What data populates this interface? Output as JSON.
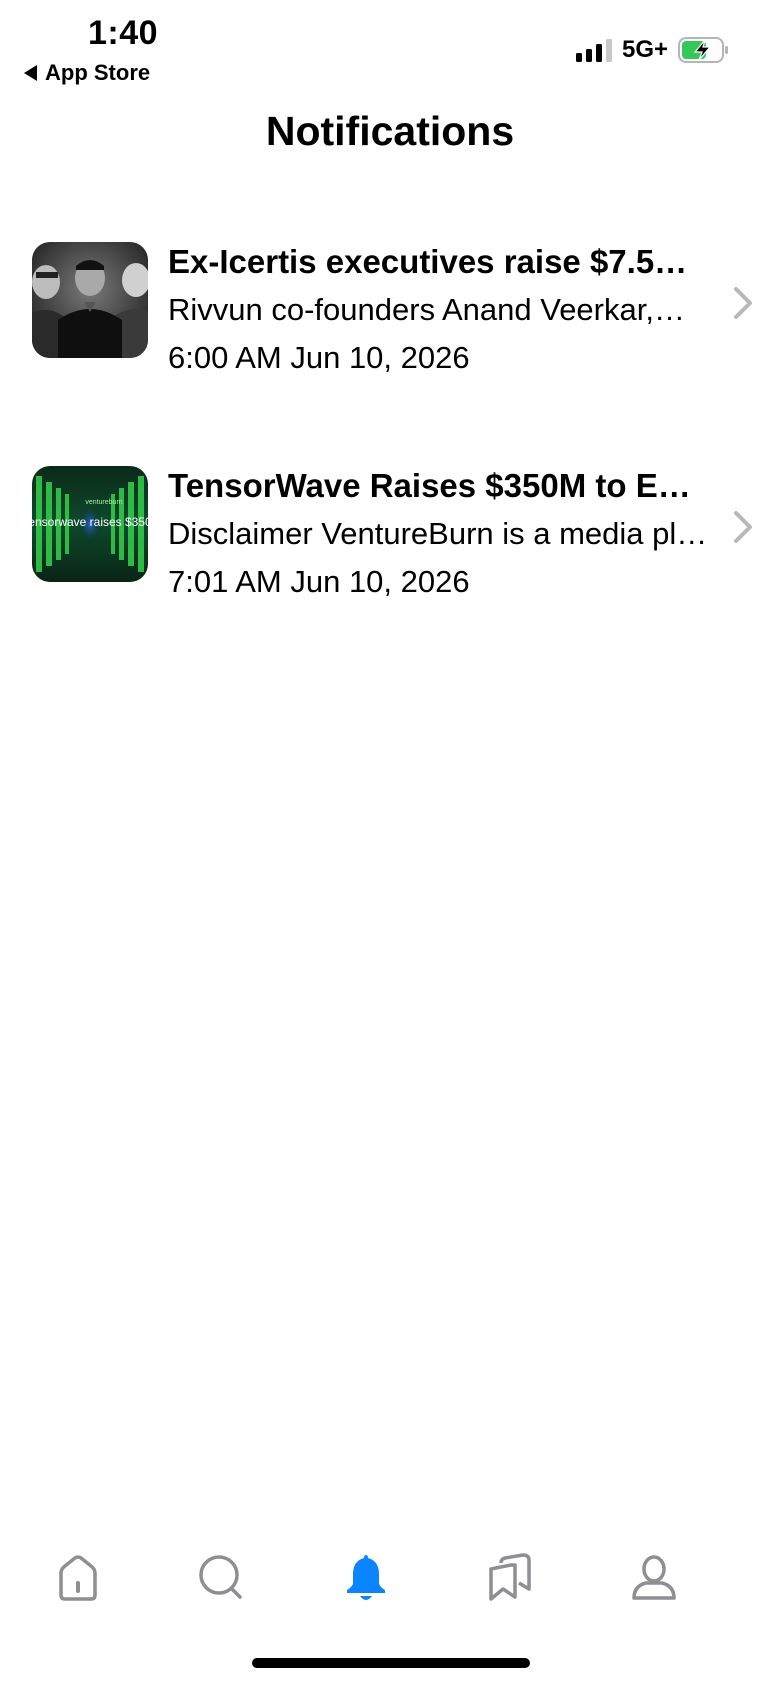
{
  "status_bar": {
    "time": "1:40",
    "back_label": "App Store",
    "network": "5G+",
    "battery_color": "#34c759"
  },
  "header": {
    "title": "Notifications"
  },
  "notifications": [
    {
      "title": "Ex-Icertis executives raise $7.5…",
      "body": "Rivvun co-founders Anand Veerkar,…",
      "time": "6:00 AM Jun 10, 2026",
      "thumbnail": "three-founders-photo"
    },
    {
      "title": "TensorWave Raises $350M to E…",
      "body": "Disclaimer VentureBurn is a media pl…",
      "time": "7:01 AM Jun 10, 2026",
      "thumbnail": "tensorwave-banner",
      "thumbnail_text": "ensorwave raises $350",
      "thumbnail_brand": "ventureburn"
    }
  ],
  "tab_bar": {
    "active_color": "#0a84ff",
    "inactive_color": "#8e8e93",
    "tabs": [
      {
        "icon": "home-icon",
        "active": false
      },
      {
        "icon": "search-icon",
        "active": false
      },
      {
        "icon": "bell-icon",
        "active": true
      },
      {
        "icon": "bookmarks-icon",
        "active": false
      },
      {
        "icon": "profile-icon",
        "active": false
      }
    ]
  }
}
